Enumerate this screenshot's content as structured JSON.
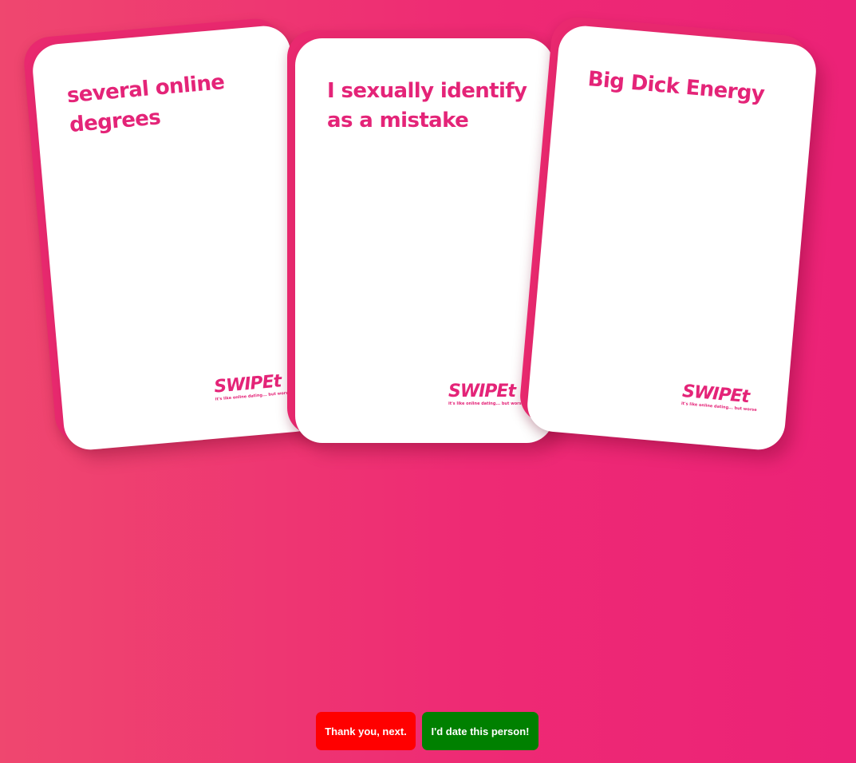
{
  "cards": [
    {
      "id": "left",
      "text": "several online degrees",
      "logo_word": "SWIPEt",
      "logo_tagline": "it's like online dating... but worse"
    },
    {
      "id": "center",
      "text": "I sexually identify as a mistake",
      "logo_word": "SWIPEt",
      "logo_tagline": "it's like online dating... but worse"
    },
    {
      "id": "right",
      "text": "Big Dick Energy",
      "logo_word": "SWIPEt",
      "logo_tagline": "it's like online dating... but worse"
    }
  ],
  "actions": {
    "reject_label": "Thank you, next.",
    "accept_label": "I'd date this person!"
  },
  "colors": {
    "background_start": "#ef476f",
    "background_end": "#ec2277",
    "card_text": "#e42478",
    "reject_button": "#ff0000",
    "accept_button": "#008000"
  }
}
